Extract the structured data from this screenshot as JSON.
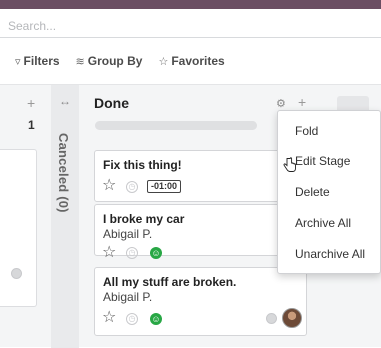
{
  "search": {
    "placeholder": "Search..."
  },
  "filters": {
    "filters_label": "Filters",
    "group_by_label": "Group By",
    "favorites_label": "Favorites"
  },
  "left_column": {
    "count": "1"
  },
  "canceled_column": {
    "label": "Canceled (0)"
  },
  "done_column": {
    "title": "Done",
    "cards": [
      {
        "title": "Fix this thing!",
        "author": "",
        "deadline": "-01:00"
      },
      {
        "title": "I broke my car",
        "author": "Abigail P."
      },
      {
        "title": "All my stuff are broken.",
        "author": "Abigail P."
      }
    ]
  },
  "menu": {
    "items": [
      "Fold",
      "Edit Stage",
      "Delete",
      "Archive All",
      "Unarchive All"
    ]
  },
  "colors": {
    "topbar": "#6b4e63",
    "priority_happy": "#28a745"
  }
}
